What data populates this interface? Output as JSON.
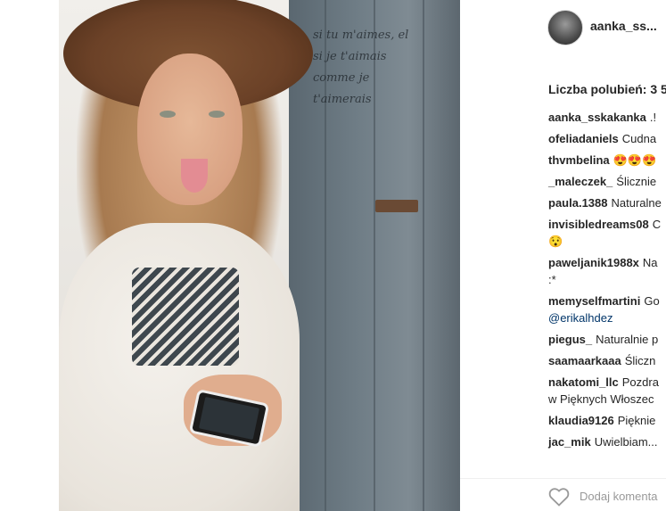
{
  "post": {
    "username": "aanka_ss...",
    "likes": "Liczba polubień: 3 5",
    "photo_icon": "post-photo",
    "door_text": [
      "si tu m'aimes, el",
      "si je t'aimais",
      "comme je t'aimerais"
    ]
  },
  "comments": [
    {
      "user": "aanka_sskakanka",
      "text": ".!",
      "cont": ""
    },
    {
      "user": "ofeliadaniels",
      "text": "Cudna",
      "cont": ""
    },
    {
      "user": "thvmbelina",
      "text": "😍😍😍",
      "cont": ""
    },
    {
      "user": "_maleczek_",
      "text": "Ślicznie",
      "cont": ""
    },
    {
      "user": "paula.1388",
      "text": "Naturalne",
      "cont": ""
    },
    {
      "user": "invisibledreams08",
      "text": "C",
      "cont": "😯"
    },
    {
      "user": "paweljanik1988x",
      "text": "Na",
      "cont": ":*"
    },
    {
      "user": "memyselfmartini",
      "text": "Go",
      "cont": "@erikalhdez",
      "cont_is_mention": true
    },
    {
      "user": "piegus_",
      "text": "Naturalnie p",
      "cont": ""
    },
    {
      "user": "saamaarkaaa",
      "text": "Śliczn",
      "cont": ""
    },
    {
      "user": "nakatomi_llc",
      "text": "Pozdra",
      "cont": "w Pięknych Włoszec"
    },
    {
      "user": "klaudia9126",
      "text": "Pięknie",
      "cont": ""
    },
    {
      "user": "jac_mik",
      "text": "Uwielbiam...",
      "cont": ""
    }
  ],
  "footer": {
    "like_icon": "heart-icon",
    "add_comment_placeholder": "Dodaj komenta"
  },
  "colors": {
    "text": "#262626",
    "muted": "#999999",
    "mention": "#003569",
    "divider": "#efefef"
  }
}
